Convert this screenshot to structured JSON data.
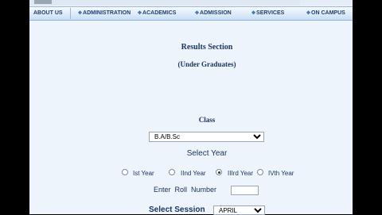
{
  "nav": {
    "items": [
      {
        "label": "ABOUT US"
      },
      {
        "label": "ADMINISTRATION"
      },
      {
        "label": "ACADEMICS"
      },
      {
        "label": "ADMISSION"
      },
      {
        "label": "SERVICES"
      },
      {
        "label": "ON CAMPUS"
      }
    ],
    "diamond": "✥"
  },
  "form": {
    "heading": "Results Section",
    "subheading": "(Under Graduates)",
    "class_label": "Class",
    "class_value": "B.A/B.Sc",
    "year_label": "Select Year",
    "years": [
      {
        "label": "Ist Year",
        "checked": false
      },
      {
        "label": "IInd Year",
        "checked": false
      },
      {
        "label": "IIIrd Year",
        "checked": true
      },
      {
        "label": "IVth Year",
        "checked": false
      }
    ],
    "roll_label": "Enter  Roll  Number",
    "roll_value": "",
    "session_label": "Select Session",
    "session_value": "APRIL"
  },
  "colors": {
    "background": "#eef4fb",
    "nav_text": "#1a3f73",
    "heading_text": "#1a3560"
  }
}
